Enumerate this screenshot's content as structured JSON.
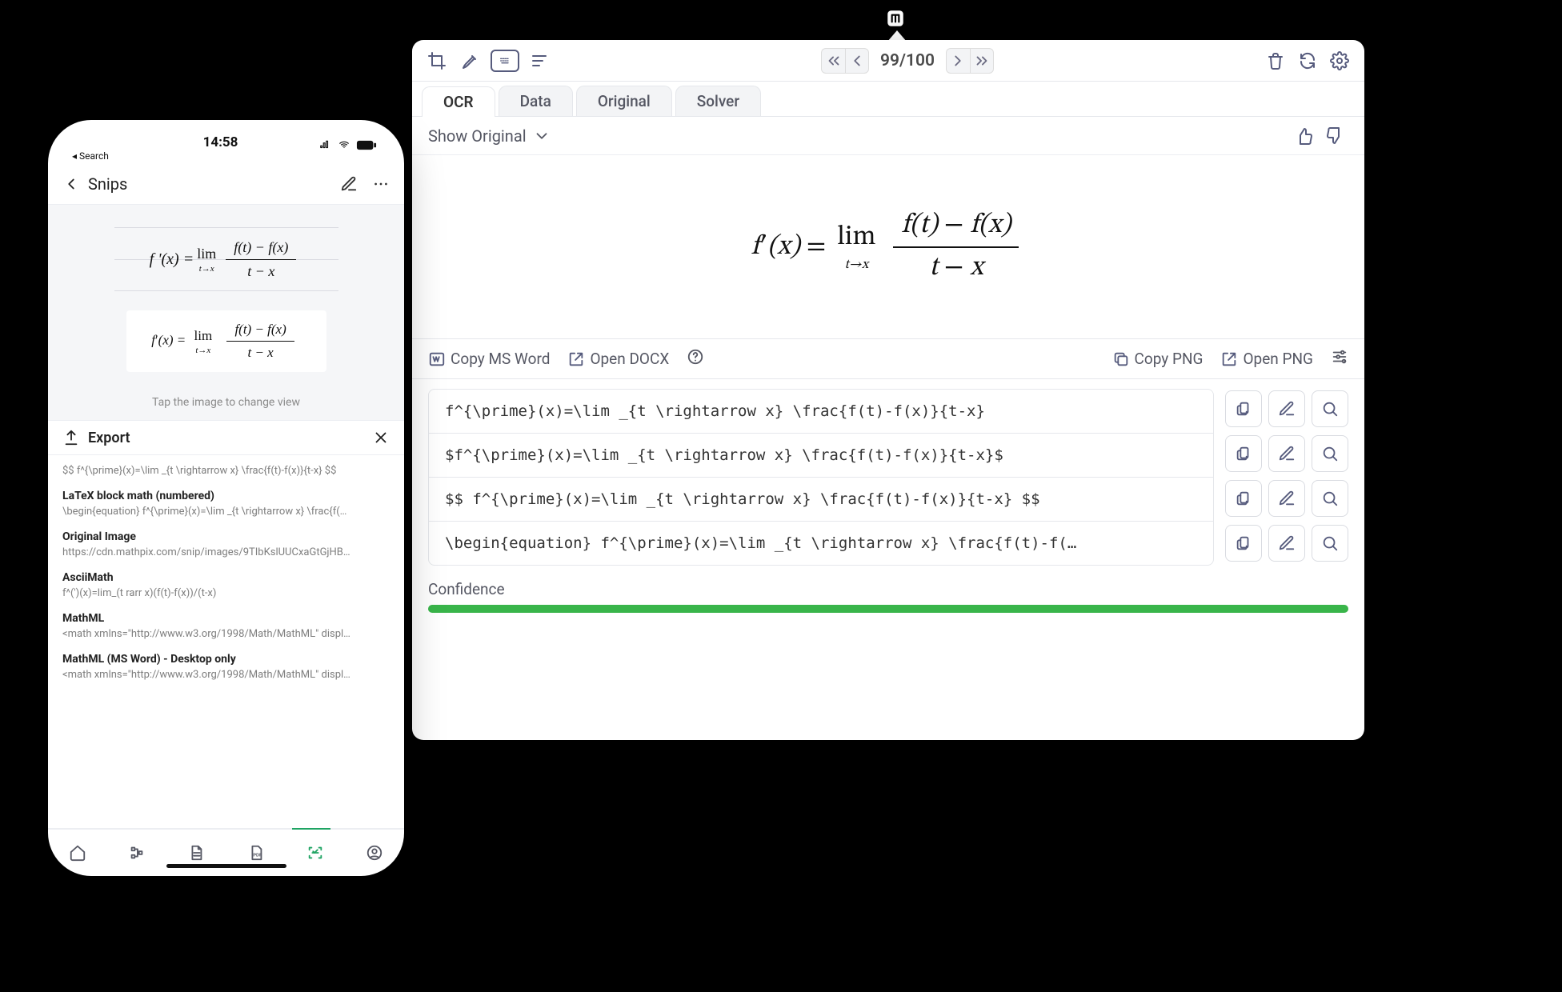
{
  "desktop": {
    "pager": {
      "current": 99,
      "total": 100,
      "label": "99/100"
    },
    "tabs": [
      {
        "label": "OCR",
        "active": true
      },
      {
        "label": "Data",
        "active": false
      },
      {
        "label": "Original",
        "active": false
      },
      {
        "label": "Solver",
        "active": false
      }
    ],
    "show_original_label": "Show Original",
    "actions": {
      "copy_ms_word": "Copy MS Word",
      "open_docx": "Open DOCX",
      "copy_png": "Copy PNG",
      "open_png": "Open PNG"
    },
    "latex_rows": [
      "f^{\\prime}(x)=\\lim _{t \\rightarrow x} \\frac{f(t)-f(x)}{t-x}",
      "$f^{\\prime}(x)=\\lim _{t \\rightarrow x} \\frac{f(t)-f(x)}{t-x}$",
      "$$ f^{\\prime}(x)=\\lim _{t \\rightarrow x} \\frac{f(t)-f(x)}{t-x} $$",
      "\\begin{equation} f^{\\prime}(x)=\\lim _{t \\rightarrow x} \\frac{f(t)-f(…"
    ],
    "confidence_label": "Confidence",
    "confidence_percent": 100
  },
  "formula": {
    "rendered": "f′(x) = lim_{t→x} (f(t) − f(x)) / (t − x)",
    "handwriting_approx": "f′(x) = lim_{t→x} (f(t) − f(x)) / (t − x)"
  },
  "phone": {
    "time": "14:58",
    "status_back": "Search",
    "title": "Snips",
    "hint": "Tap the image to change view",
    "export_label": "Export",
    "exports": [
      {
        "header": "",
        "body": "$$ f^{\\prime}(x)=\\lim _{t \\rightarrow x} \\frac{f(t)-f(x)}{t-x} $$"
      },
      {
        "header": "LaTeX block math (numbered)",
        "body": "\\begin{equation} f^{\\prime}(x)=\\lim _{t \\rightarrow x} \\frac{f(…"
      },
      {
        "header": "Original Image",
        "body": "https://cdn.mathpix.com/snip/images/9TIbKslUUCxaGtGjHB…"
      },
      {
        "header": "AsciiMath",
        "body": "f^(')(x)=lim_(t rarr x)(f(t)-f(x))/(t-x)"
      },
      {
        "header": "MathML",
        "body": "<math xmlns=\"http://www.w3.org/1998/Math/MathML\" displ…"
      },
      {
        "header": "MathML (MS Word) - Desktop only",
        "body": "<math xmlns=\"http://www.w3.org/1998/Math/MathML\" displ…"
      }
    ]
  },
  "icons": {
    "crop": "crop-icon",
    "edit": "pen-icon",
    "keyboard": "keyboard-icon",
    "lines": "lines-icon",
    "first": "chevrons-left-icon",
    "prev": "chevron-left-icon",
    "next": "chevron-right-icon",
    "last": "chevrons-right-icon",
    "trash": "trash-icon",
    "refresh": "refresh-icon",
    "settings": "gear-icon",
    "thumbs_up": "thumbs-up-icon",
    "thumbs_down": "thumbs-down-icon",
    "word": "word-icon",
    "open": "open-external-icon",
    "help": "help-icon",
    "copy_img": "copy-image-icon",
    "sliders": "sliders-icon",
    "clipboard": "clipboard-icon",
    "edit_box": "edit-box-icon",
    "search": "search-icon",
    "upload": "upload-icon",
    "close": "close-icon",
    "home": "home-icon",
    "tree": "tree-icon",
    "doc": "document-icon",
    "pdf": "pdf-icon",
    "scan": "scan-icon",
    "profile": "profile-icon",
    "compose": "compose-icon",
    "more": "more-icon",
    "chevron_down": "chevron-down-icon",
    "chevron_left_thin": "chevron-left-icon"
  }
}
